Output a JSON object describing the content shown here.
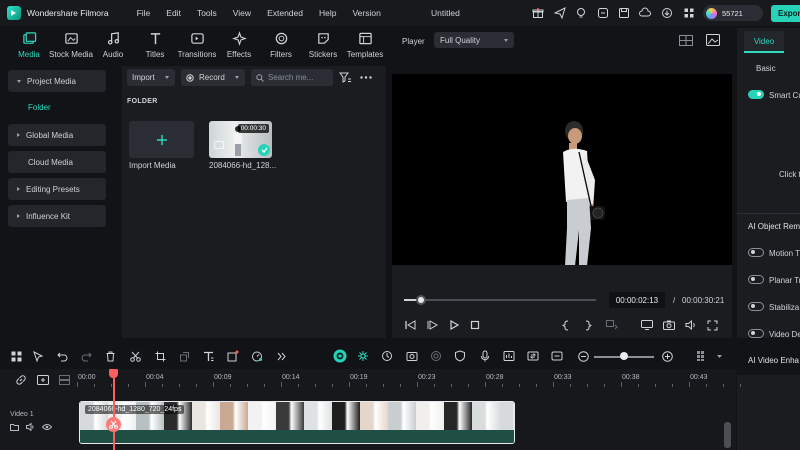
{
  "app": {
    "name": "Wondershare Filmora",
    "doc_title": "Untitled",
    "menu": [
      "File",
      "Edit",
      "Tools",
      "View",
      "Extended",
      "Help",
      "Version"
    ],
    "credits": "55721",
    "export_label": "Expor"
  },
  "media_tabs": [
    {
      "label": "Media",
      "icon": "media-icon",
      "active": true
    },
    {
      "label": "Stock Media",
      "icon": "stock-media-icon"
    },
    {
      "label": "Audio",
      "icon": "audio-icon"
    },
    {
      "label": "Titles",
      "icon": "titles-icon"
    },
    {
      "label": "Transitions",
      "icon": "transitions-icon"
    },
    {
      "label": "Effects",
      "icon": "effects-icon"
    },
    {
      "label": "Filters",
      "icon": "filters-icon"
    },
    {
      "label": "Stickers",
      "icon": "stickers-icon"
    },
    {
      "label": "Templates",
      "icon": "templates-icon"
    }
  ],
  "sidebar": {
    "items": [
      {
        "label": "Project Media",
        "expanded": true
      },
      {
        "label": "Global Media"
      },
      {
        "label": "Cloud Media"
      },
      {
        "label": "Editing Presets"
      },
      {
        "label": "Influence Kit"
      }
    ],
    "folder": "Folder"
  },
  "media": {
    "import_label": "Import",
    "record_label": "Record",
    "search_placeholder": "Search me...",
    "folder_heading": "FOLDER",
    "import_media_label": "Import Media",
    "clip": {
      "name": "2084066-hd_128...",
      "duration": "00:00:30"
    }
  },
  "player": {
    "label": "Player",
    "quality": "Full Quality",
    "time_current": "00:00:02:13",
    "time_separator": "/",
    "time_total": "00:00:30:21",
    "progress": 0.09
  },
  "right_panel": {
    "tab": "Video",
    "basic": "Basic",
    "smart_cutout": "Smart Cu",
    "click_hint": "Click t",
    "ai_object_remover": "AI Object Rem",
    "motion_tracking": "Motion T",
    "planar_tracking": "Planar Tr",
    "stabilization": "Stabiliza",
    "video_denoise": "Video De",
    "ai_video_enhancer": "AI Video Enha"
  },
  "timeline": {
    "ticks": [
      "00:00",
      "00:04",
      "00:09",
      "00:14",
      "00:19",
      "00:23",
      "00:28",
      "00:33",
      "00:38",
      "00:43"
    ],
    "track_name": "Video 1",
    "clip_title": "2084066-hd_1280_720_24fps"
  },
  "colors": {
    "accent": "#27d3b6",
    "playhead": "#ff5c5c"
  }
}
